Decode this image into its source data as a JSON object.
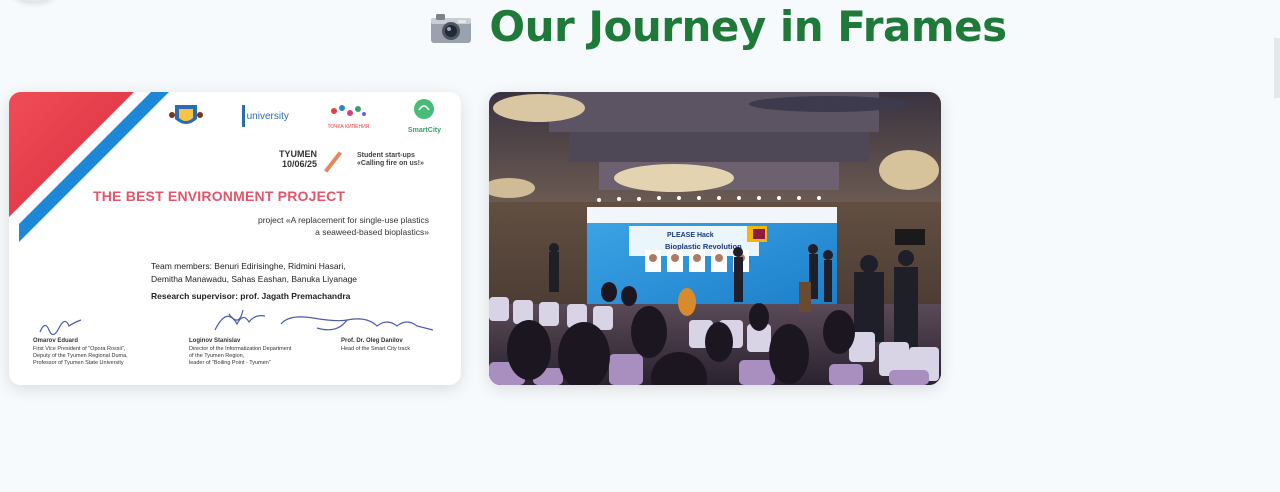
{
  "section": {
    "title": "Our Journey in Frames",
    "icon": "camera-icon"
  },
  "gallery": {
    "certificate": {
      "city": "TYUMEN",
      "date": "10/06/25",
      "track_line1": "Student start-ups",
      "track_line2": "«Calling fire on us!»",
      "logo_university": "university",
      "logo_tochka": "ТОЧКА КИПЕНИЯ",
      "logo_smartcity": "SmartCity",
      "title": "THE BEST ENVIRONMENT PROJECT",
      "project_line1": "project «A replacement for single-use plastics",
      "project_line2": "a seaweed-based bioplastics»",
      "team_line1": "Team members: Benuri Edirisinghe, Ridmini Hasari,",
      "team_line2": "Demitha Manawadu, Sahas Eashan, Banuka Liyanage",
      "supervisor": "Research supervisor: prof. Jagath Premachandra",
      "signers": [
        {
          "name": "Omarov Eduard",
          "l1": "First Vice President of \"Opora Rossii\",",
          "l2": "Deputy of the Tyumen Regional Duma,",
          "l3": "Professor of Tyumen State University"
        },
        {
          "name": "Loginov Stanislav",
          "l1": "Director of the Informatization Department",
          "l2": "of the Tyumen Region,",
          "l3": "leader of \"Boiling Point - Tyumen\""
        },
        {
          "name": "Prof. Dr. Oleg Danilov",
          "l1": "Head of the Smart City track",
          "l2": "",
          "l3": ""
        }
      ]
    },
    "event_photo": {
      "screen_heading": "PLEASE Hack",
      "screen_title": "Bioplastic Revolution"
    }
  },
  "colors": {
    "heading": "#1f7a3a",
    "cert_red": "#e8394a",
    "cert_blue": "#1e88d6",
    "cert_title": "#e0566a"
  }
}
